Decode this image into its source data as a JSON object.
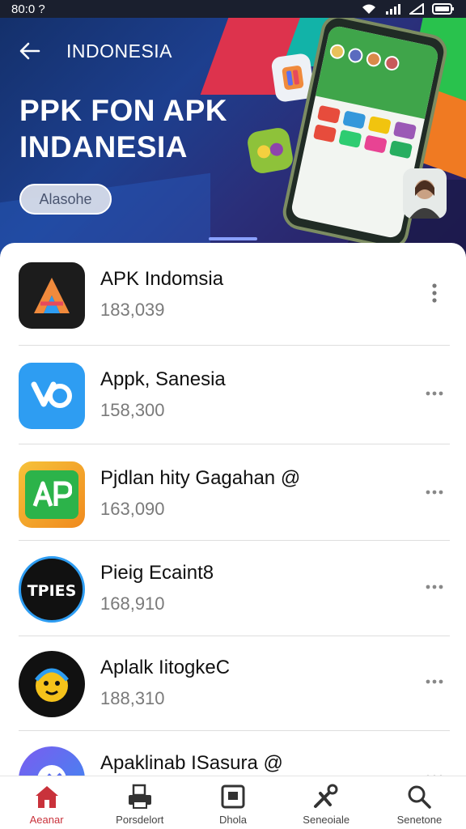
{
  "status_bar": {
    "time": "80:0 ?"
  },
  "hero": {
    "breadcrumb": "INDONESIA",
    "title": "PPK FON APK INDANESIA",
    "button_label": "Alasohe"
  },
  "apps": [
    {
      "name": "APK Indomsia",
      "count": "183,039",
      "icon": "apk-a-logo-icon",
      "color": "#1c1c1c"
    },
    {
      "name": "Appk, Sanesia",
      "count": "158,300",
      "icon": "blue-logo-icon",
      "color": "#2e9df2"
    },
    {
      "name": "Pjdlan hity Gagahan @",
      "count": "163,090",
      "icon": "ap-logo-icon",
      "color": "#2cb34a"
    },
    {
      "name": "Pieig Ecaint8",
      "count": "168,910",
      "icon": "tpies-logo-icon",
      "color": "#111111"
    },
    {
      "name": "Aplalk IitogkeC",
      "count": "188,310",
      "icon": "emoji-face-icon",
      "color": "#111111"
    },
    {
      "name": "Apaklinab ISasura @",
      "count": "",
      "icon": "messenger-logo-icon",
      "color": "#6b5bef"
    }
  ],
  "nav": [
    {
      "label": "Aeanar",
      "icon": "home-icon",
      "active": true
    },
    {
      "label": "Porsdelort",
      "icon": "printer-icon",
      "active": false
    },
    {
      "label": "Dhola",
      "icon": "box-icon",
      "active": false
    },
    {
      "label": "Seneoiale",
      "icon": "tools-icon",
      "active": false
    },
    {
      "label": "Senetone",
      "icon": "search-icon",
      "active": false
    }
  ],
  "colors": {
    "accent": "#c9323b",
    "hero_bg": "#1d3f8e"
  }
}
